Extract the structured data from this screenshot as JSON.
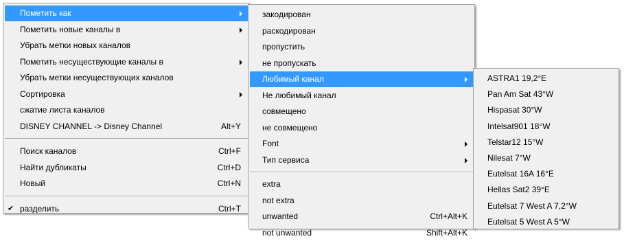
{
  "main_menu": {
    "groups": [
      {
        "items": [
          {
            "label": "Пометить как",
            "submenu": true,
            "selected": true
          },
          {
            "label": "Пометить новые каналы в",
            "submenu": true
          },
          {
            "label": "Убрать метки новых каналов"
          },
          {
            "label": "Пометить несуществующие каналы в",
            "submenu": true
          },
          {
            "label": "Убрать метки несуществующих каналов"
          },
          {
            "label": "Сортировка",
            "submenu": true
          },
          {
            "label": "сжатие листа каналов"
          },
          {
            "label": "DISNEY CHANNEL -> Disney Channel",
            "shortcut": "Alt+Y"
          }
        ]
      },
      {
        "items": [
          {
            "label": "Поиск каналов",
            "shortcut": "Ctrl+F"
          },
          {
            "label": "Найти дубликаты",
            "shortcut": "Ctrl+D"
          },
          {
            "label": "Новый",
            "shortcut": "Ctrl+N"
          }
        ]
      },
      {
        "items": [
          {
            "label": "разделить",
            "shortcut": "Ctrl+T",
            "checked": true
          }
        ]
      }
    ]
  },
  "submenu_mark_as": {
    "groups": [
      {
        "items": [
          {
            "label": "закодирован"
          },
          {
            "label": "раскодирован"
          },
          {
            "label": "пропустить"
          },
          {
            "label": "не пропускать"
          },
          {
            "label": "Любимый канал",
            "submenu": true,
            "selected": true
          },
          {
            "label": "Не любимый канал"
          },
          {
            "label": " совмещено"
          },
          {
            "label": " не совмещено"
          },
          {
            "label": "Font",
            "submenu": true
          },
          {
            "label": "Тип сервиса",
            "submenu": true
          }
        ]
      },
      {
        "items": [
          {
            "label": "extra"
          },
          {
            "label": "not extra"
          },
          {
            "label": "unwanted",
            "shortcut": "Ctrl+Alt+K"
          },
          {
            "label": "not unwanted",
            "shortcut": "Shift+Alt+K"
          }
        ]
      }
    ]
  },
  "submenu_favorite": {
    "groups": [
      {
        "items": [
          {
            "label": "ASTRA1 19,2°E"
          },
          {
            "label": "Pan Am Sat 43°W"
          },
          {
            "label": "Hispasat 30°W"
          },
          {
            "label": "Intelsat901 18°W"
          },
          {
            "label": "Telstar12 15°W"
          },
          {
            "label": "Nilesat 7°W"
          },
          {
            "label": "Eutelsat 16A 16°E"
          },
          {
            "label": "Hellas Sat2 39°E"
          },
          {
            "label": "Eutelsat 7 West A 7,2°W"
          },
          {
            "label": "Eutelsat 5 West A 5°W"
          }
        ]
      }
    ]
  }
}
